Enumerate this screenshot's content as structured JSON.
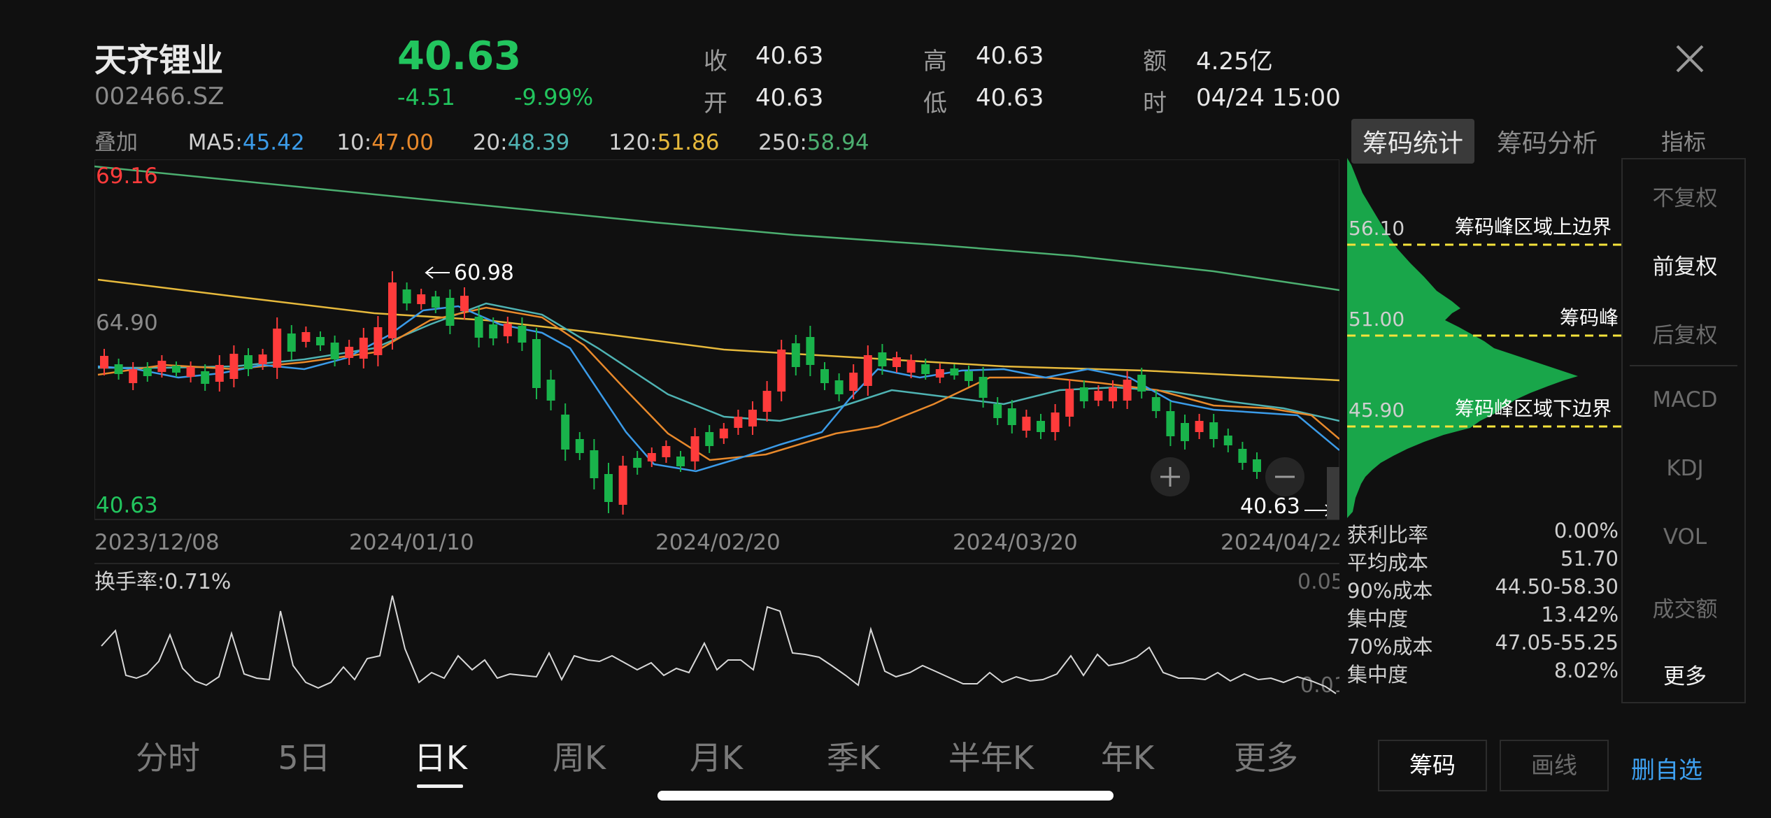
{
  "header": {
    "name": "天齐锂业",
    "code": "002466.SZ",
    "price": "40.63",
    "change": "-4.51",
    "change_pct": "-9.99%",
    "quote": {
      "close_label": "收",
      "close": "40.63",
      "open_label": "开",
      "open": "40.63",
      "high_label": "高",
      "high": "40.63",
      "low_label": "低",
      "low": "40.63",
      "amount_label": "额",
      "amount": "4.25亿",
      "time_label": "时",
      "time": "04/24 15:00"
    }
  },
  "ma_row": {
    "overlay": "叠加",
    "ma5_label": "MA5",
    "ma5": "45.42",
    "ma10_label": "10",
    "ma10": "47.00",
    "ma20_label": "20",
    "ma20": "48.39",
    "ma120_label": "120",
    "ma120": "51.86",
    "ma250_label": "250",
    "ma250": "58.94",
    "colors": {
      "ma5": "#3b9be8",
      "ma10": "#e8892b",
      "ma20": "#4fb3b3",
      "ma120": "#e6b93c",
      "ma250": "#4caf70"
    }
  },
  "kline": {
    "max_label": "69.16",
    "ref_label": "64.90",
    "min_label": "40.63",
    "peak_annot": "60.98",
    "last_annot": "40.63",
    "dates": [
      "2023/12/08",
      "2024/01/10",
      "2024/02/20",
      "2024/03/20",
      "2024/04/24"
    ]
  },
  "chip": {
    "tab_stats": "筹码统计",
    "tab_analysis": "筹码分析",
    "upper_price": "56.10",
    "upper_label": "筹码峰区域上边界",
    "peak_price": "51.00",
    "peak_label": "筹码峰",
    "lower_price": "45.90",
    "lower_label": "筹码峰区域下边界",
    "stats": [
      {
        "label": "获利比率",
        "value": "0.00%"
      },
      {
        "label": "平均成本",
        "value": "51.70"
      },
      {
        "label": "90%成本",
        "value": "44.50-58.30"
      },
      {
        "label": "集中度",
        "value": "13.42%"
      },
      {
        "label": "70%成本",
        "value": "47.05-55.25"
      },
      {
        "label": "集中度",
        "value": "8.02%"
      }
    ]
  },
  "turnover": {
    "label": "换手率:0.71%",
    "top": "0.05",
    "bottom": "0.01"
  },
  "indicators": {
    "header": "指标",
    "items": [
      "不复权",
      "前复权",
      "后复权",
      "MACD",
      "KDJ",
      "VOL",
      "成交额",
      "更多"
    ],
    "active": "前复权"
  },
  "periods": [
    "分时",
    "5日",
    "日K",
    "周K",
    "月K",
    "季K",
    "半年K",
    "年K",
    "更多"
  ],
  "active_period": "日K",
  "bottom_buttons": {
    "chip": "筹码",
    "draw": "画线",
    "remove": "删自选"
  },
  "colors": {
    "up": "#ff3b3b",
    "down": "#19b34b",
    "chip_fill": "#19a64a",
    "dashed": "#f5e23b"
  }
}
